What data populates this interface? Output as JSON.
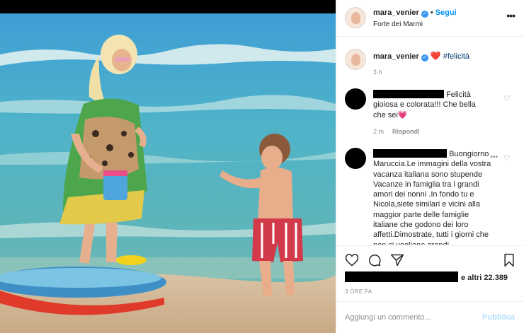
{
  "post": {
    "image_alt": "",
    "colors": {
      "accent": "#0095f6",
      "verified": "#3897f0",
      "heart": "#e0245e"
    }
  },
  "header": {
    "username": "mara_venier",
    "separator": "•",
    "follow_label": "Segui",
    "location": "Forte dei Marmi",
    "more_icon": "ellipsis-icon"
  },
  "caption": {
    "username": "mara_venier",
    "emoji": "❤️",
    "hashtag": "#felicità",
    "time": "3 h"
  },
  "comments": [
    {
      "text": "Felicità gioiosa e colorata!!! Che bella che sei",
      "emoji": "💗",
      "time": "2 m",
      "reply_label": "Rispondi"
    },
    {
      "text": "Buongiorno Maruccia.Le immagini della vostra vacanza italiana sono stupende Vacanze in famiglia tra i grandi amori dei nonni .In fondo tu e Nicola,siete similari e vicini alla maggior parte delle famiglie italiane che godono dei loro affetti.Dimostrate, tutti i giorni che non ci vogliono grandi"
    }
  ],
  "actions": {
    "like_icon": "heart-icon",
    "comment_icon": "comment-icon",
    "share_icon": "paper-plane-icon",
    "save_icon": "bookmark-icon"
  },
  "likes": {
    "suffix": "e altri 22.389"
  },
  "posted": "3 ORE FA",
  "add_comment": {
    "placeholder": "Aggiungi un commento...",
    "publish_label": "Pubblica"
  }
}
